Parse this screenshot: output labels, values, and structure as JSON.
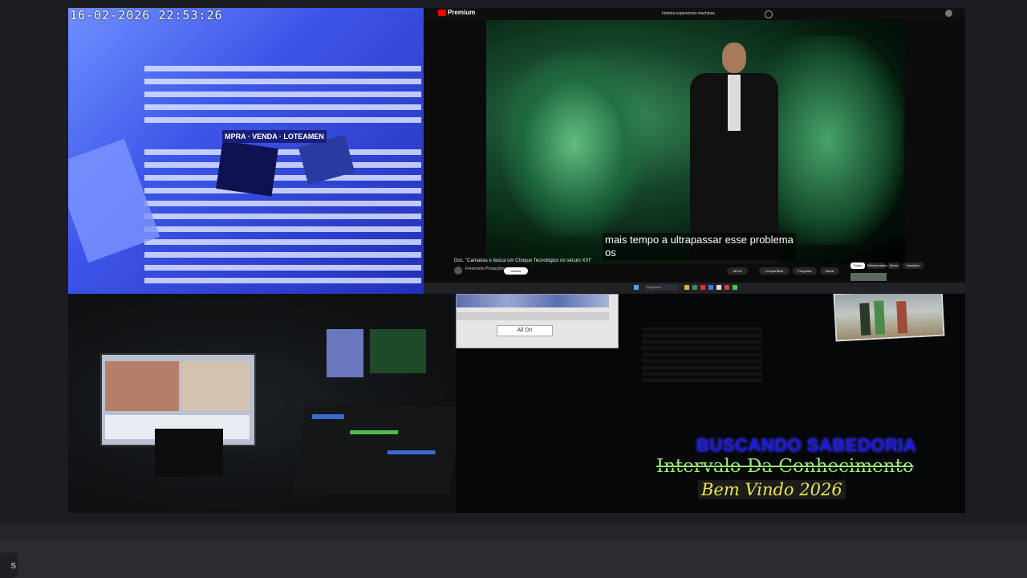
{
  "camera": {
    "timestamp": "16-02-2026  22:53:26",
    "sign_text": "MPRA · VENDA · LOTEAMEN"
  },
  "youtube": {
    "logo": "Premium",
    "search_text": "historia esperiencia machinas",
    "subtitle_line1": "mais tempo a ultrapassar esse problema",
    "subtitle_line2": "os",
    "video_title": "Doc. \"Camadas e busca um Choque Tecnológico no século XVI\"",
    "channel": "Fenomínio Produções",
    "subscribe_label": "Inscrito",
    "actions": [
      "88 mil",
      "Compartilhar",
      "Perguntar",
      "Salvar"
    ],
    "chips": [
      "Todos",
      "Relacionados",
      "Movie",
      "Assistido"
    ],
    "search_taskbar": "Pesquisar"
  },
  "dialog": {
    "button_label": "All On"
  },
  "overlay": {
    "line1": "BUSCANDO SABEDORIA",
    "line2": "Intervalo Da Conhecimento",
    "line3": "Bem Vindo 2026"
  },
  "bottom": {
    "tab_label": "s"
  },
  "colors": {
    "camera_blue": "#3d55e8",
    "green_scene": "#3a8f5a",
    "overlay_blue": "#1d19d8",
    "overlay_green": "#9ff07a",
    "overlay_yellow": "#e9e64d"
  }
}
